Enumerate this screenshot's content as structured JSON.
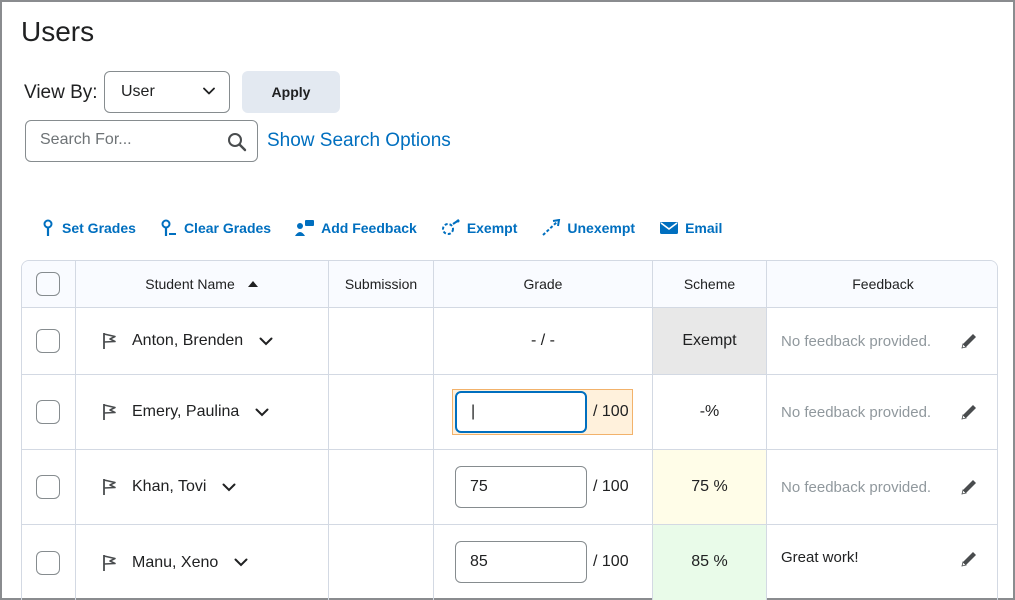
{
  "page": {
    "title": "Users"
  },
  "view_by": {
    "label": "View By:",
    "selected": "User",
    "apply_label": "Apply"
  },
  "search": {
    "placeholder": "Search For...",
    "options_link": "Show Search Options"
  },
  "toolbar": {
    "items": [
      {
        "label": "Set Grades",
        "icon": "set-grades-icon"
      },
      {
        "label": "Clear Grades",
        "icon": "clear-grades-icon"
      },
      {
        "label": "Add Feedback",
        "icon": "add-feedback-icon"
      },
      {
        "label": "Exempt",
        "icon": "exempt-icon"
      },
      {
        "label": "Unexempt",
        "icon": "unexempt-icon"
      },
      {
        "label": "Email",
        "icon": "email-icon"
      }
    ]
  },
  "table": {
    "headers": {
      "name": "Student Name",
      "submission": "Submission",
      "grade": "Grade",
      "scheme": "Scheme",
      "feedback": "Feedback"
    },
    "rows": [
      {
        "name": "Anton, Brenden",
        "grade_text": "- / -",
        "grade_value": "",
        "out_of": "",
        "scheme": "Exempt",
        "scheme_bg": "#e8e8e8",
        "feedback": "No feedback provided."
      },
      {
        "name": "Emery, Paulina",
        "grade_text": "",
        "grade_value": "|",
        "out_of": "/ 100",
        "scheme": "-%",
        "scheme_bg": "#ffffff",
        "feedback": "No feedback provided."
      },
      {
        "name": "Khan, Tovi",
        "grade_text": "",
        "grade_value": "75",
        "out_of": "/ 100",
        "scheme": "75 %",
        "scheme_bg": "#fffde8",
        "feedback": "No feedback provided."
      },
      {
        "name": "Manu, Xeno",
        "grade_text": "",
        "grade_value": "85",
        "out_of": "/ 100",
        "scheme": "85 %",
        "scheme_bg": "#e9fbe9",
        "feedback": "Great work!"
      }
    ]
  },
  "colors": {
    "link": "#006fbf",
    "border": "#d3d9e3"
  }
}
